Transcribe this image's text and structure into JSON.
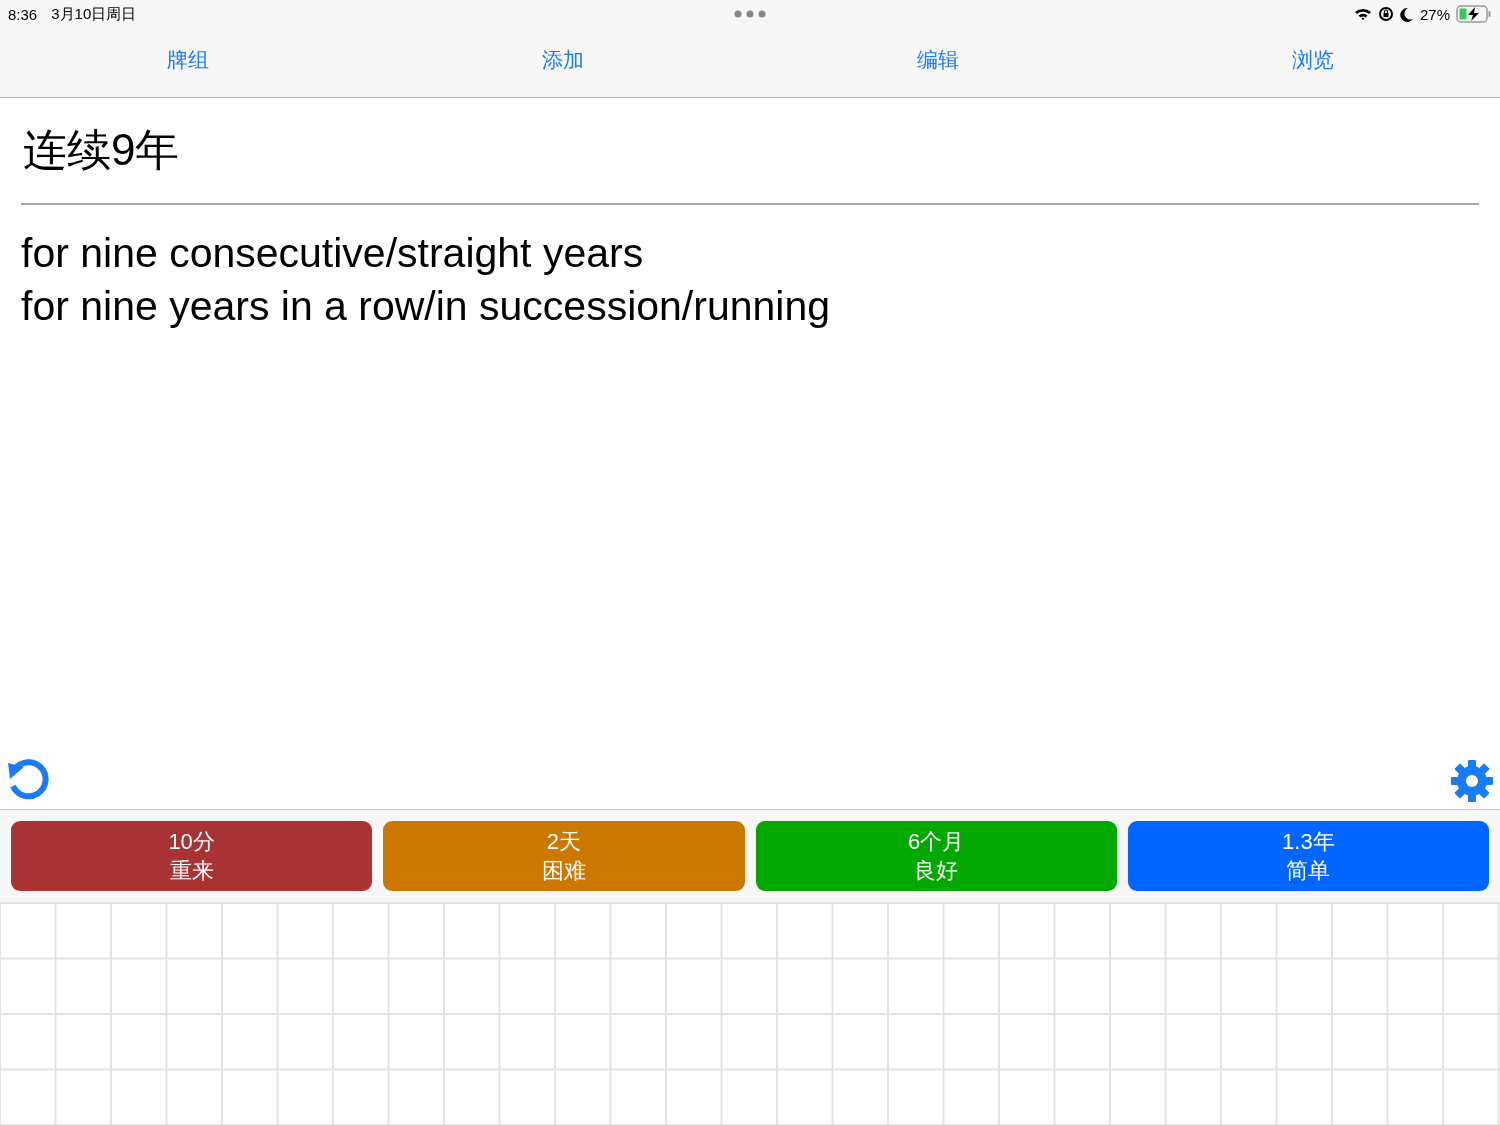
{
  "status_bar": {
    "time": "8:36",
    "date": "3月10日周日",
    "battery": "27%"
  },
  "tabs": [
    {
      "label": "牌组"
    },
    {
      "label": "添加"
    },
    {
      "label": "编辑"
    },
    {
      "label": "浏览"
    }
  ],
  "card": {
    "question": "连续9年",
    "answer": [
      "for nine consecutive/straight years",
      "for nine years in a row/in succession/running"
    ]
  },
  "answer_buttons": [
    {
      "interval": "10分",
      "label": "重来",
      "color": "#a83234"
    },
    {
      "interval": "2天",
      "label": "困难",
      "color": "#cc7700"
    },
    {
      "interval": "6个月",
      "label": "良好",
      "color": "#00a800"
    },
    {
      "interval": "1.3年",
      "label": "简单",
      "color": "#0066ff"
    }
  ]
}
